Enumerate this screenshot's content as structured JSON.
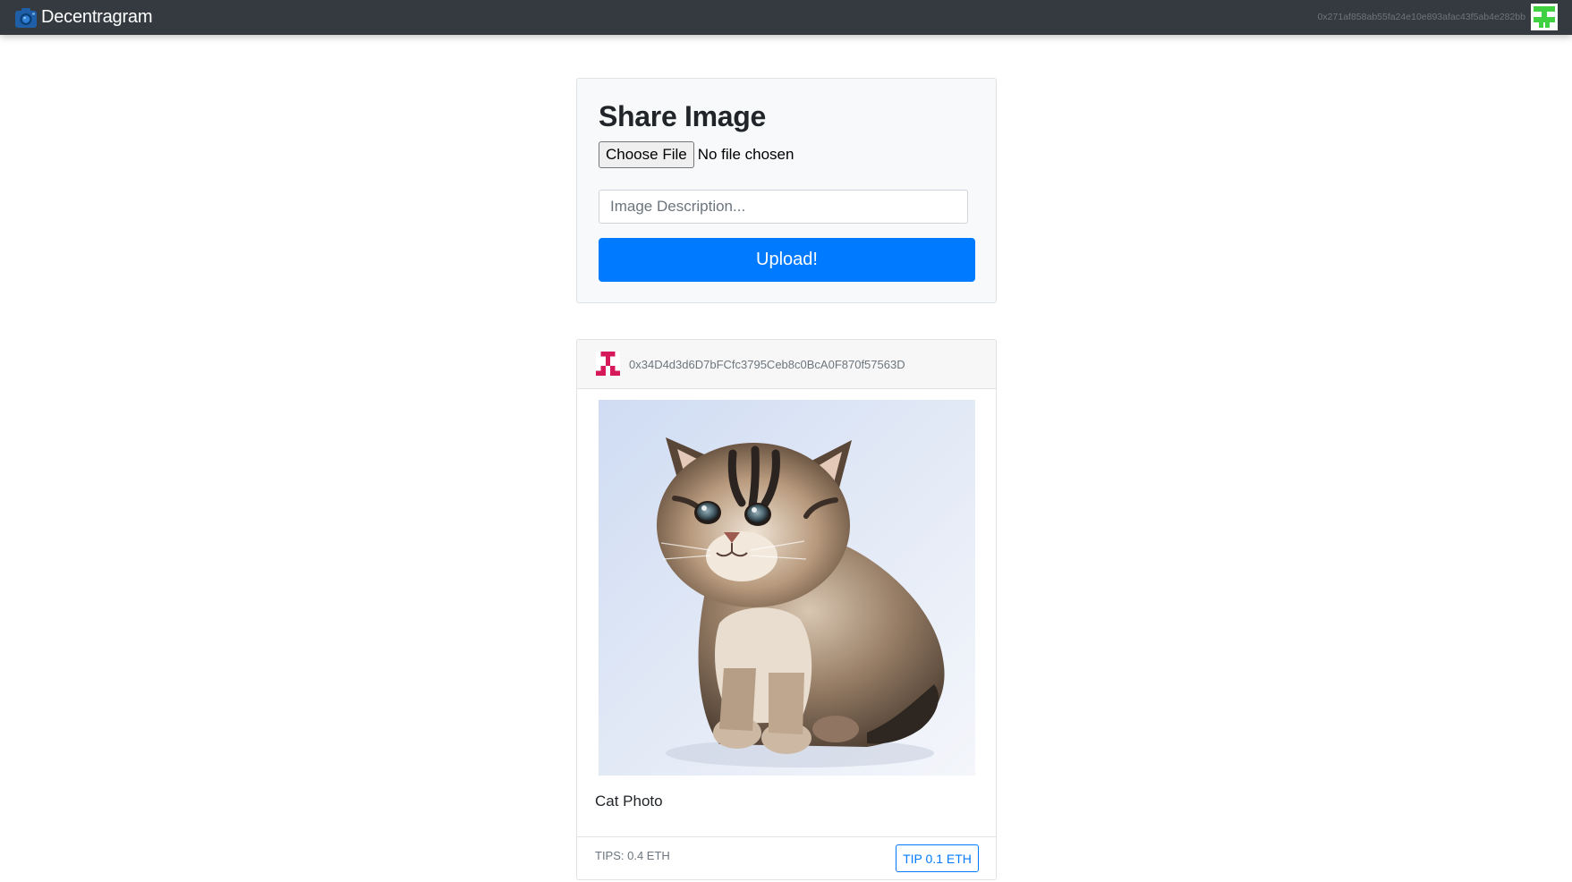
{
  "navbar": {
    "brand_icon": "camera-icon",
    "brand_name": "Decentragram",
    "account_address": "0x271af858ab55fa24e10e893afac43f5ab4e282bb",
    "account_avatar": "identicon-avatar-green"
  },
  "share_form": {
    "title": "Share Image",
    "file_button_label": "Choose File",
    "file_status": "No file chosen",
    "description_placeholder": "Image Description...",
    "upload_label": "Upload!"
  },
  "posts": [
    {
      "author_avatar": "identicon-avatar-crimson",
      "author_address": "0x34D4d3d6D7bFCfc3795Ceb8c0BcA0F870f57563D",
      "image_alt": "kitten photo",
      "description": "Cat Photo",
      "tips_label": "TIPS: 0.4 ETH",
      "tip_button_label": "TIP 0.1 ETH"
    }
  ],
  "colors": {
    "navbar_bg": "#343a40",
    "primary": "#007bff",
    "card_bg": "#f8f9fa",
    "muted": "#6c757d",
    "account_identicon": "#3fd13f",
    "author_identicon": "#d6195a"
  }
}
